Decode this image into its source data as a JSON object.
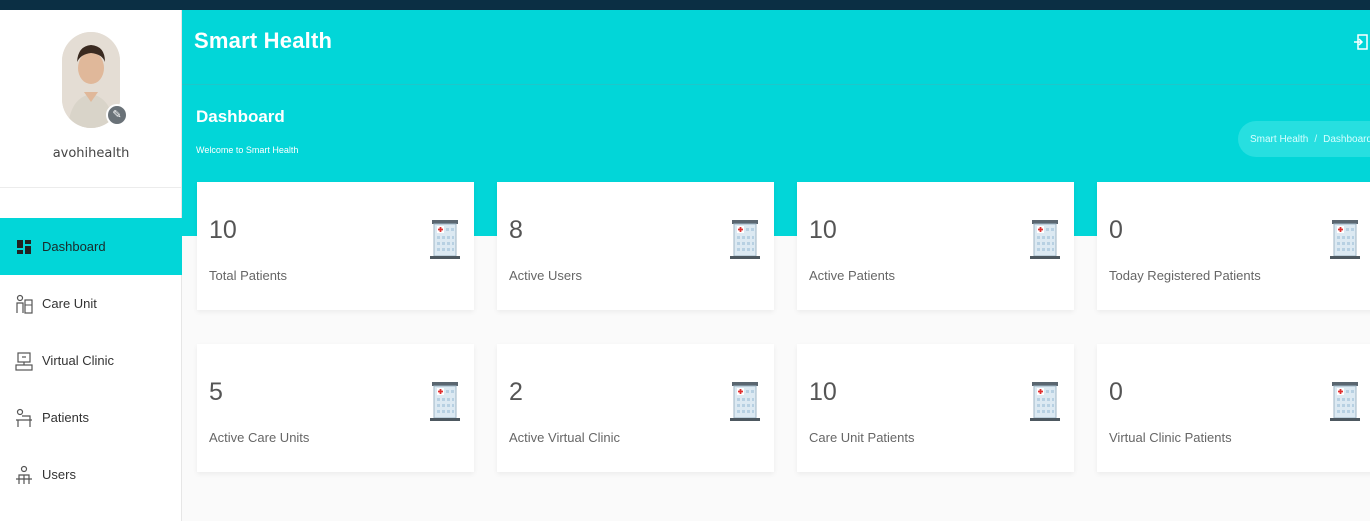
{
  "app": {
    "title": "Smart Health"
  },
  "user": {
    "name": "avohihealth"
  },
  "sidebar": {
    "items": [
      {
        "label": "Dashboard",
        "icon": "dashboard-icon",
        "active": true
      },
      {
        "label": "Care Unit",
        "icon": "care-unit-icon",
        "active": false
      },
      {
        "label": "Virtual Clinic",
        "icon": "virtual-clinic-icon",
        "active": false
      },
      {
        "label": "Patients",
        "icon": "patients-icon",
        "active": false
      },
      {
        "label": "Users",
        "icon": "users-icon",
        "active": false
      }
    ]
  },
  "header": {
    "title": "Dashboard",
    "subtitle": "Welcome to Smart Health",
    "breadcrumb": [
      "Smart Health",
      "Dashboard"
    ]
  },
  "cards": [
    {
      "value": "10",
      "label": "Total Patients",
      "icon": "hospital-icon"
    },
    {
      "value": "8",
      "label": "Active Users",
      "icon": "hospital-icon"
    },
    {
      "value": "10",
      "label": "Active Patients",
      "icon": "hospital-icon"
    },
    {
      "value": "0",
      "label": "Today Registered Patients",
      "icon": "hospital-icon"
    },
    {
      "value": "5",
      "label": "Active Care Units",
      "icon": "hospital-icon"
    },
    {
      "value": "2",
      "label": "Active Virtual Clinic",
      "icon": "hospital-icon"
    },
    {
      "value": "10",
      "label": "Care Unit Patients",
      "icon": "hospital-icon"
    },
    {
      "value": "0",
      "label": "Virtual Clinic Patients",
      "icon": "hospital-icon"
    }
  ],
  "colors": {
    "accent": "#02d6d8",
    "frame": "#0b2f44",
    "card": "#ffffff",
    "background": "#fafafa"
  }
}
